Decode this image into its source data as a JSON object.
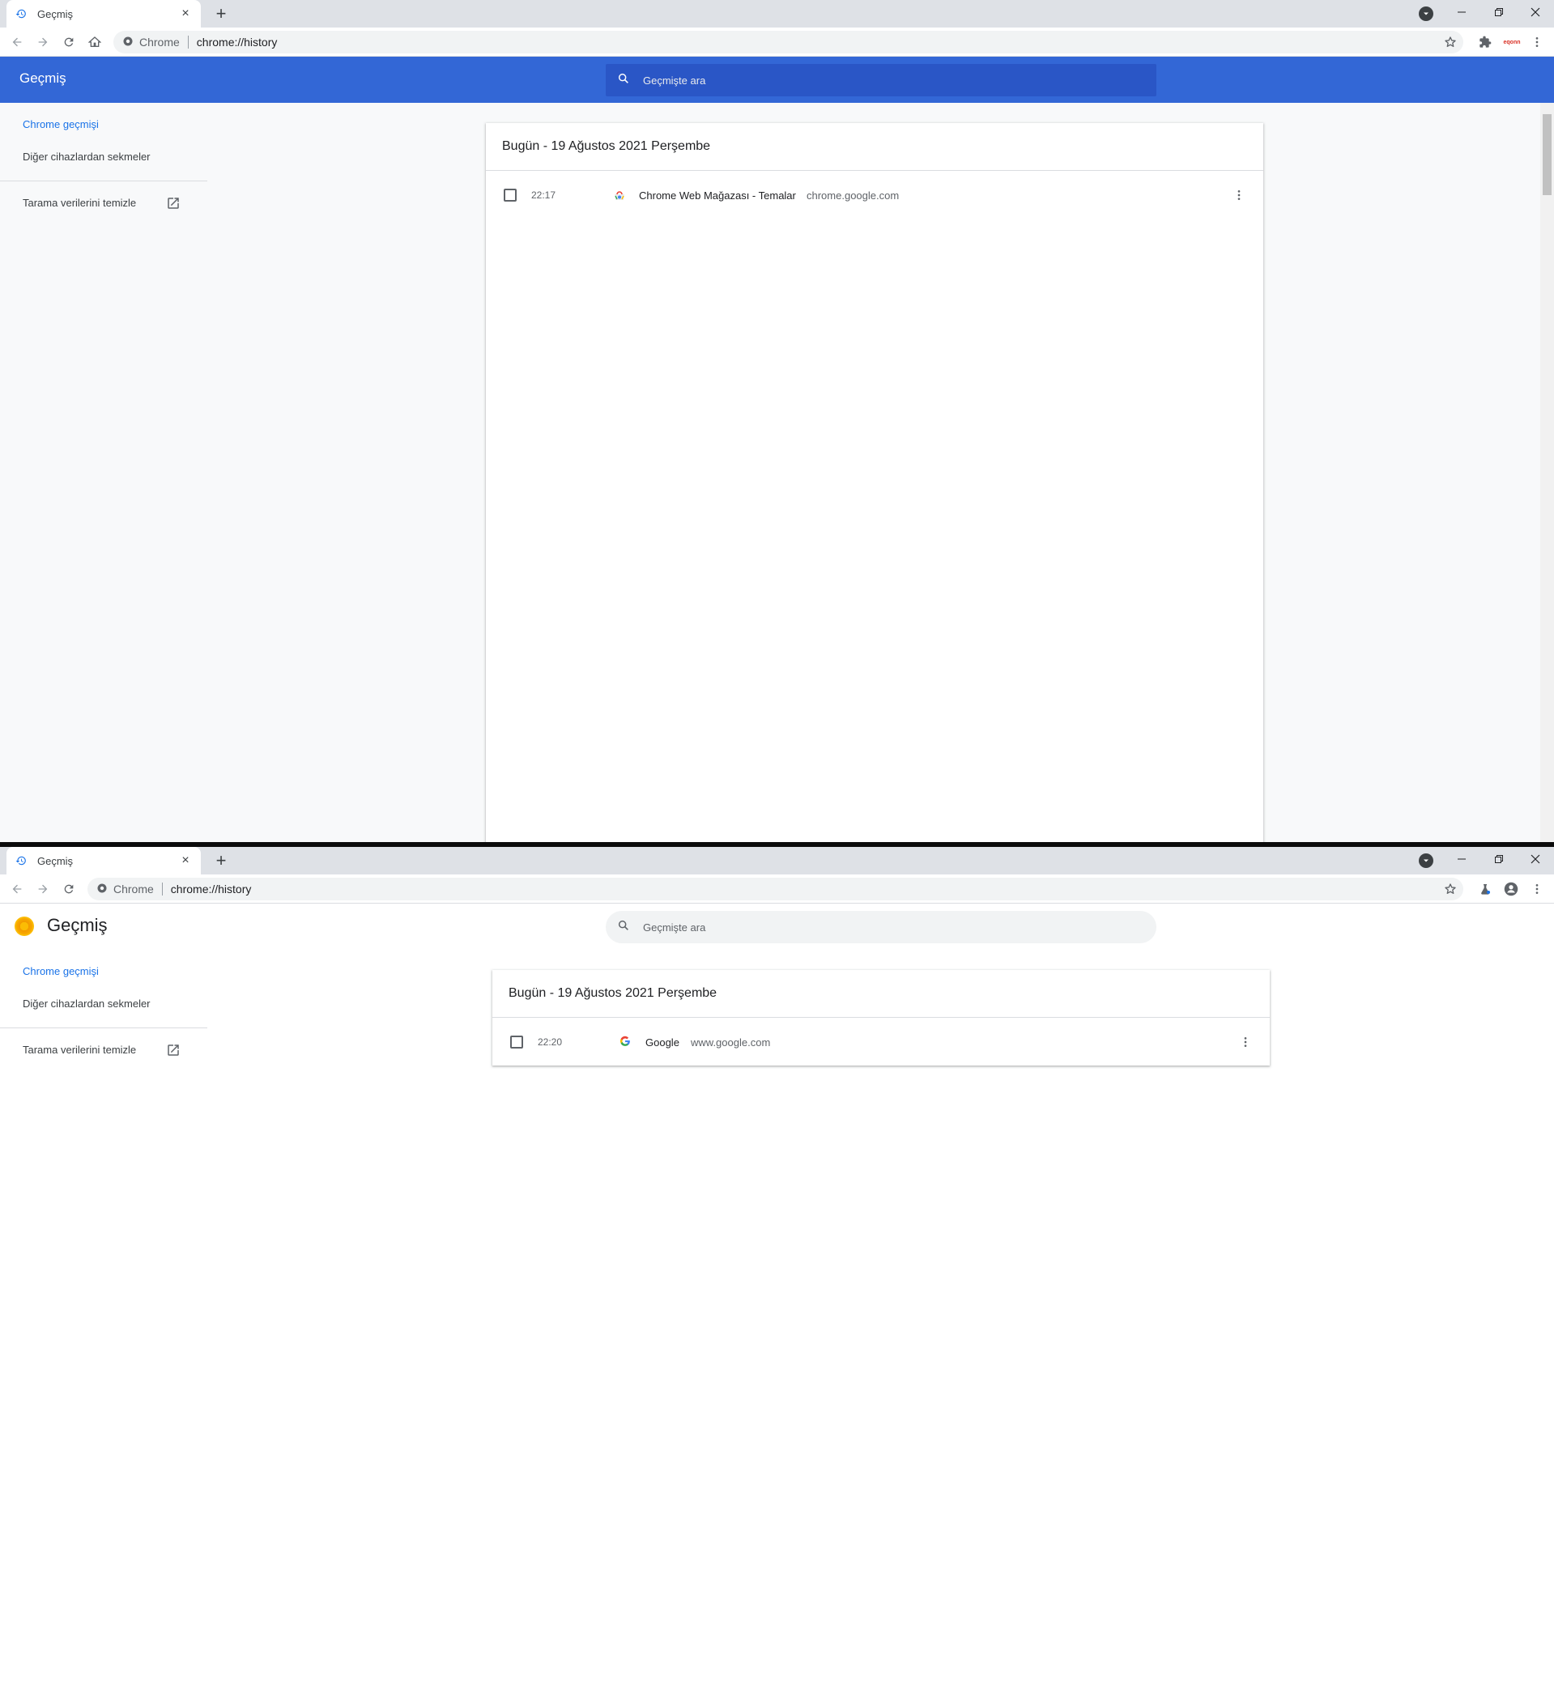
{
  "windows": [
    {
      "tab": {
        "title": "Geçmiş",
        "close": "×"
      },
      "newtab": "+",
      "omnibox": {
        "chip": "Chrome",
        "url": "chrome://history"
      },
      "ext_badge": "eqonn",
      "header": {
        "title": "Geçmiş",
        "search_placeholder": "Geçmişte ara"
      },
      "sidebar": {
        "items": [
          "Chrome geçmişi",
          "Diğer cihazlardan sekmeler"
        ],
        "clear": "Tarama verilerini temizle"
      },
      "day_title": "Bugün - 19 Ağustos 2021 Perşembe",
      "entries": [
        {
          "time": "22:17",
          "title": "Chrome Web Mağazası - Temalar",
          "domain": "chrome.google.com"
        }
      ]
    },
    {
      "tab": {
        "title": "Geçmiş",
        "close": "×"
      },
      "newtab": "+",
      "omnibox": {
        "chip": "Chrome",
        "url": "chrome://history"
      },
      "header": {
        "title": "Geçmiş",
        "search_placeholder": "Geçmişte ara"
      },
      "sidebar": {
        "items": [
          "Chrome geçmişi",
          "Diğer cihazlardan sekmeler"
        ],
        "clear": "Tarama verilerini temizle"
      },
      "day_title": "Bugün - 19 Ağustos 2021 Perşembe",
      "entries": [
        {
          "time": "22:20",
          "title": "Google",
          "domain": "www.google.com"
        }
      ]
    }
  ],
  "colors": {
    "accent": "#1a73e8",
    "header_blue": "#3367d6",
    "search_blue": "#2a56c6"
  },
  "icons": [
    "history-icon",
    "close-icon",
    "plus-icon",
    "back-arrow-icon",
    "forward-arrow-icon",
    "reload-icon",
    "home-icon",
    "star-icon",
    "puzzle-icon",
    "kebab-icon",
    "search-icon",
    "external-link-icon",
    "profile-icon",
    "labs-icon"
  ]
}
